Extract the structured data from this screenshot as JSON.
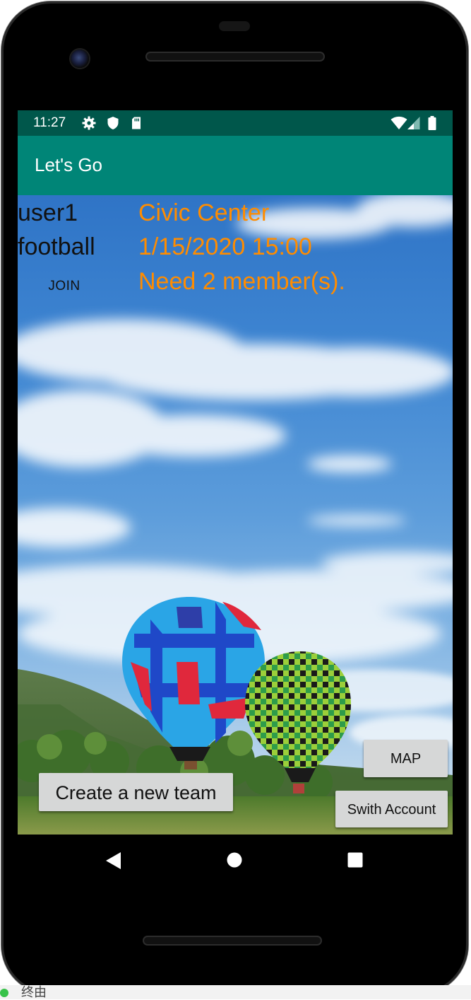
{
  "status_bar": {
    "time": "11:27",
    "left_icons": [
      "gear-icon",
      "shield-icon",
      "sd-card-icon"
    ],
    "right_icons": [
      "wifi-icon",
      "signal-icon",
      "battery-icon"
    ]
  },
  "app_bar": {
    "title": "Let's Go"
  },
  "team_card": {
    "user": "user1",
    "sport": "football",
    "join_label": "JOIN",
    "location": "Civic Center",
    "datetime": "1/15/2020 15:00",
    "needed": "Need 2 member(s)."
  },
  "buttons": {
    "create_label": "Create a new team",
    "map_label": "MAP",
    "switch_label": "Swith Account"
  },
  "nav": {
    "back": "back-icon",
    "home": "home-icon",
    "recents": "recents-icon"
  },
  "footer": {
    "text": "终由"
  },
  "colors": {
    "status_bar": "#00574B",
    "app_bar": "#008577",
    "accent_text": "#FF8C00",
    "button_bg": "#D6D7D7"
  }
}
